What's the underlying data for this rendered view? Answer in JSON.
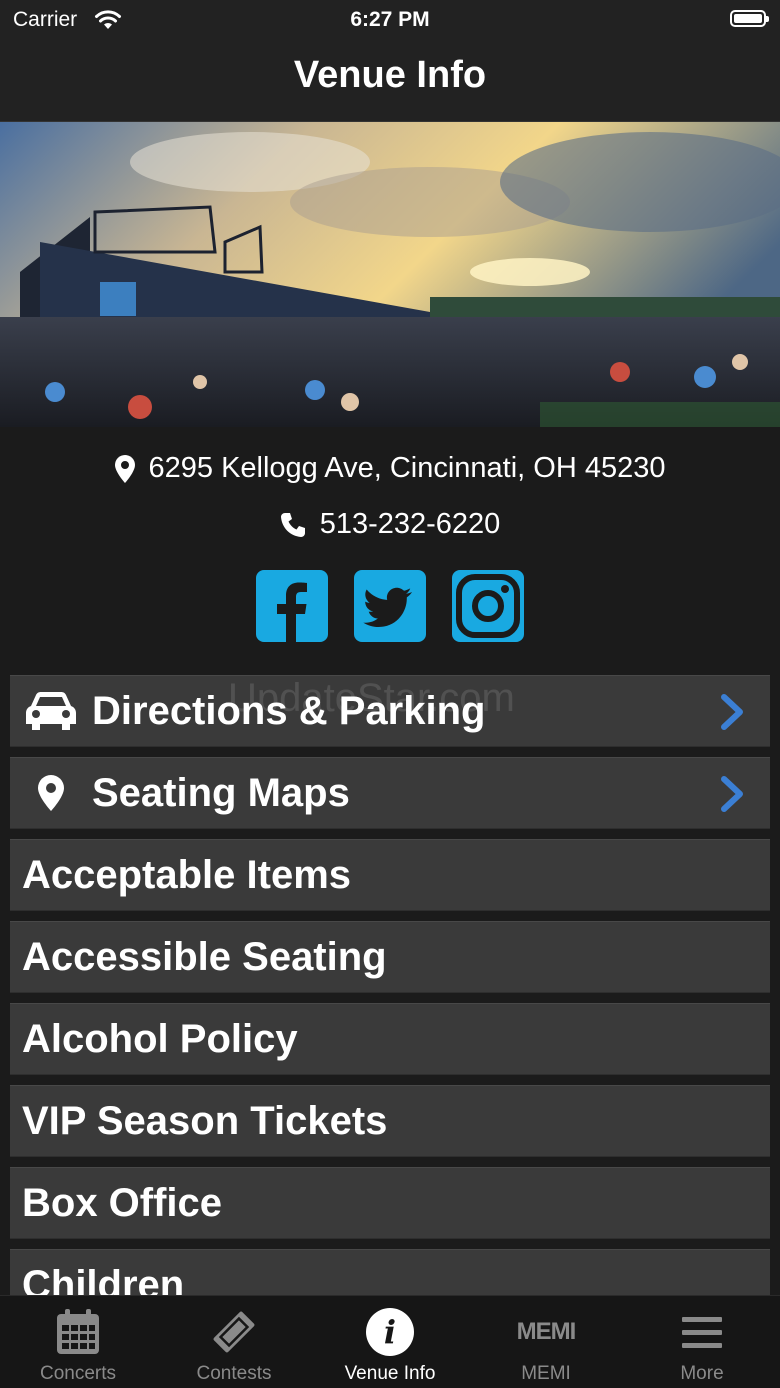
{
  "status_bar": {
    "carrier": "Carrier",
    "time": "6:27 PM"
  },
  "nav": {
    "title": "Venue Info"
  },
  "venue": {
    "address": "6295 Kellogg Ave, Cincinnati, OH 45230",
    "phone": "513-232-6220"
  },
  "social": [
    {
      "name": "facebook-icon"
    },
    {
      "name": "twitter-icon"
    },
    {
      "name": "instagram-icon"
    }
  ],
  "menu": {
    "directions": "Directions & Parking",
    "seating": "Seating Maps",
    "acceptable": "Acceptable Items",
    "accessible": "Accessible Seating",
    "alcohol": "Alcohol Policy",
    "vip": "VIP Season Tickets",
    "box_office": "Box Office",
    "children": "Children"
  },
  "watermark": "UpdateStar.com",
  "tabs": {
    "concerts": "Concerts",
    "contests": "Contests",
    "venue_info": "Venue Info",
    "memi": "MEMI",
    "memi_logo": "MEMI",
    "more": "More"
  },
  "colors": {
    "accent_social": "#19a9e1",
    "chevron": "#3b7fd4",
    "background": "#1b1b1b",
    "list_item": "#3a3a3a"
  }
}
